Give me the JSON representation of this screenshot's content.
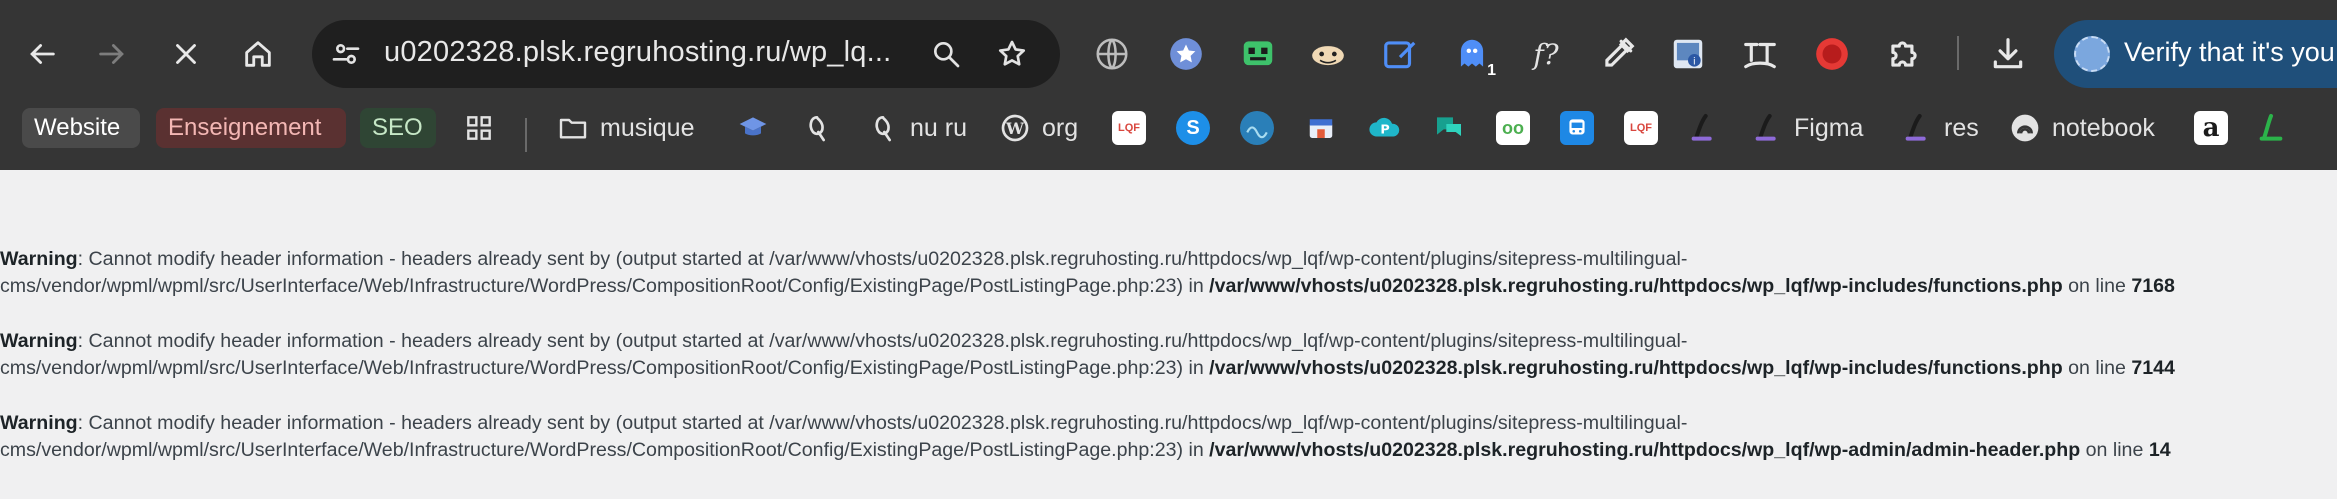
{
  "browser": {
    "url": "u0202328.plsk.regruhosting.ru/wp_lq...",
    "verify_label": "Verify that it's you",
    "extensions": [
      {
        "name": "globe-icon"
      },
      {
        "name": "star-badge-icon"
      },
      {
        "name": "robot-icon"
      },
      {
        "name": "dolphin-icon"
      },
      {
        "name": "edit-square-icon"
      },
      {
        "name": "ghost-icon",
        "badge": "1"
      },
      {
        "name": "font-question-icon",
        "label": "f?"
      },
      {
        "name": "eyedropper-icon"
      },
      {
        "name": "image-info-icon"
      },
      {
        "name": "text-tool-icon"
      },
      {
        "name": "record-icon"
      },
      {
        "name": "puzzle-icon"
      },
      {
        "name": "download-icon"
      }
    ]
  },
  "bookmarks": {
    "groups": [
      "Website",
      "Enseignement",
      "SEO"
    ],
    "items": [
      {
        "label": "musique",
        "icon": "folder-icon"
      },
      {
        "label": "",
        "icon": "graduation-cap-icon"
      },
      {
        "label": "",
        "icon": "q-script-icon"
      },
      {
        "label": "nu ru",
        "icon": "q-script-icon"
      },
      {
        "label": "org",
        "icon": "wordpress-icon"
      },
      {
        "label": "Figma",
        "icon": "l-script-icon"
      },
      {
        "label": "res",
        "icon": "l-script-icon"
      },
      {
        "label": "notebook",
        "icon": "notebook-icon"
      }
    ],
    "favicons": [
      {
        "text": "LQF",
        "name": "lqf-favicon"
      },
      {
        "text": "S",
        "name": "skype-favicon"
      },
      {
        "text": "",
        "name": "wave-favicon"
      },
      {
        "text": "",
        "name": "store-favicon"
      },
      {
        "text": "P",
        "name": "cloud-p-favicon"
      },
      {
        "text": "",
        "name": "chat-favicon"
      },
      {
        "text": "oo",
        "name": "loop-favicon"
      },
      {
        "text": "",
        "name": "bus-favicon"
      },
      {
        "text": "LQF",
        "name": "lqf2-favicon"
      },
      {
        "text": "a",
        "name": "amazon-favicon"
      }
    ]
  },
  "warnings": [
    {
      "label": "Warning",
      "message": ": Cannot modify header information - headers already sent by (output started at /var/www/vhosts/u0202328.plsk.regruhosting.ru/httpdocs/wp_lqf/wp-content/plugins/sitepress-multilingual-",
      "message2": "cms/vendor/wpml/wpml/src/UserInterface/Web/Infrastructure/WordPress/CompositionRoot/Config/ExistingPage/PostListingPage.php:23) in ",
      "file": "/var/www/vhosts/u0202328.plsk.regruhosting.ru/httpdocs/wp_lqf/wp-includes/functions.php",
      "online": " on line ",
      "line": "7168"
    },
    {
      "label": "Warning",
      "message": ": Cannot modify header information - headers already sent by (output started at /var/www/vhosts/u0202328.plsk.regruhosting.ru/httpdocs/wp_lqf/wp-content/plugins/sitepress-multilingual-",
      "message2": "cms/vendor/wpml/wpml/src/UserInterface/Web/Infrastructure/WordPress/CompositionRoot/Config/ExistingPage/PostListingPage.php:23) in ",
      "file": "/var/www/vhosts/u0202328.plsk.regruhosting.ru/httpdocs/wp_lqf/wp-includes/functions.php",
      "online": " on line ",
      "line": "7144"
    },
    {
      "label": "Warning",
      "message": ": Cannot modify header information - headers already sent by (output started at /var/www/vhosts/u0202328.plsk.regruhosting.ru/httpdocs/wp_lqf/wp-content/plugins/sitepress-multilingual-",
      "message2": "cms/vendor/wpml/wpml/src/UserInterface/Web/Infrastructure/WordPress/CompositionRoot/Config/ExistingPage/PostListingPage.php:23) in ",
      "file": "/var/www/vhosts/u0202328.plsk.regruhosting.ru/httpdocs/wp_lqf/wp-admin/admin-header.php",
      "online": " on line ",
      "line": "14"
    }
  ]
}
